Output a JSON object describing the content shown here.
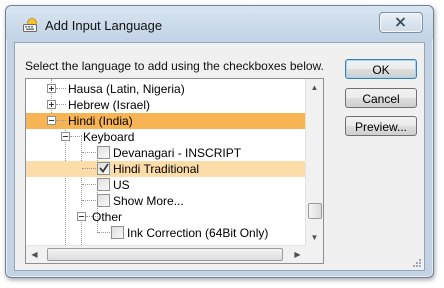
{
  "window": {
    "title": "Add Input Language",
    "close_label": "Close"
  },
  "dialog": {
    "instruction": "Select the language to add using the checkboxes below."
  },
  "tree": {
    "hausa": "Hausa (Latin, Nigeria)",
    "hebrew": "Hebrew (Israel)",
    "hindi": "Hindi (India)",
    "keyboard": "Keyboard",
    "devanagari": "Devanagari - INSCRIPT",
    "hindi_traditional": "Hindi Traditional",
    "us": "US",
    "show_more": "Show More...",
    "other": "Other",
    "ink_correction": "Ink Correction (64Bit Only)"
  },
  "checks": {
    "devanagari": false,
    "hindi_traditional": true,
    "us": false,
    "show_more": false,
    "ink_correction": false
  },
  "buttons": {
    "ok": "OK",
    "cancel": "Cancel",
    "preview": "Preview..."
  },
  "colors": {
    "selected_row": "#f7b454",
    "hover_row": "#fcdca8",
    "frame": "#c4d3e3"
  },
  "icons": {
    "title": "keyboard-globe-icon",
    "close": "close-x-icon"
  }
}
